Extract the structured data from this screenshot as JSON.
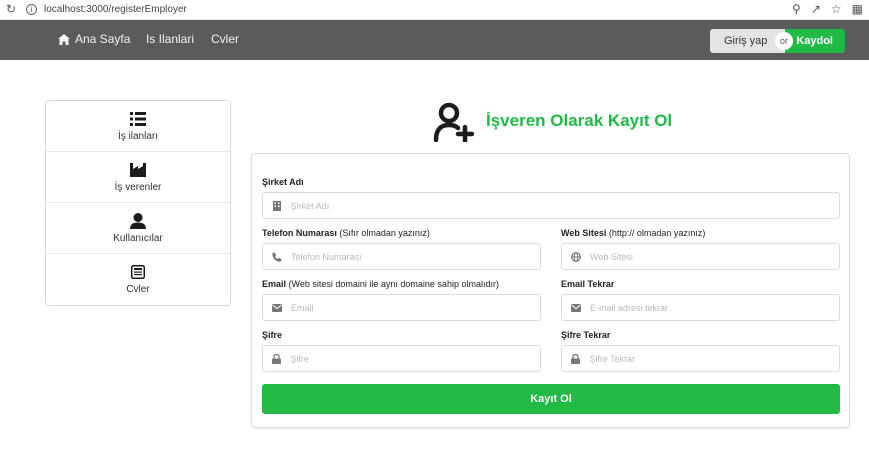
{
  "browser": {
    "url": "localhost:3000/registerEmployer"
  },
  "navbar": {
    "home_label": "Ana Sayfa",
    "jobs_label": "Is Ilanlari",
    "cvs_label": "Cvler",
    "login_label": "Giriş yap",
    "or_label": "or",
    "register_label": "Kaydol"
  },
  "sidebar": {
    "items": [
      {
        "label": "İş ilanları",
        "icon": "list-icon"
      },
      {
        "label": "İş verenler",
        "icon": "industry-icon"
      },
      {
        "label": "Kullanıcılar",
        "icon": "user-icon"
      },
      {
        "label": "Cvler",
        "icon": "newspaper-icon"
      }
    ]
  },
  "header": {
    "title": "İşveren Olarak Kayıt Ol",
    "icon": "user-plus-icon"
  },
  "form": {
    "company": {
      "label": "Şirket Adı",
      "note": "",
      "placeholder": "Şirket Adı"
    },
    "phone": {
      "label": "Telefon Numarası",
      "note": "(Sıfır olmadan yazınız)",
      "placeholder": "Telefon Numarası"
    },
    "website": {
      "label": "Web Sitesi",
      "note": "(http:// olmadan yazınız)",
      "placeholder": "Web Sitesi"
    },
    "email": {
      "label": "Email",
      "note": "(Web sitesi domaini ile aynı domaine sahip olmalıdır)",
      "placeholder": "Email"
    },
    "email_repeat": {
      "label": "Email Tekrar",
      "note": "",
      "placeholder": "E-mail adresi tekrar"
    },
    "password": {
      "label": "Şifre",
      "note": "",
      "placeholder": "Şifre"
    },
    "password_repeat": {
      "label": "Şifre Tekrar",
      "note": "",
      "placeholder": "Şifre Tekrar"
    },
    "submit_label": "Kayıt Ol"
  },
  "colors": {
    "accent": "#21ba45",
    "navbar": "#5b5b5b"
  }
}
